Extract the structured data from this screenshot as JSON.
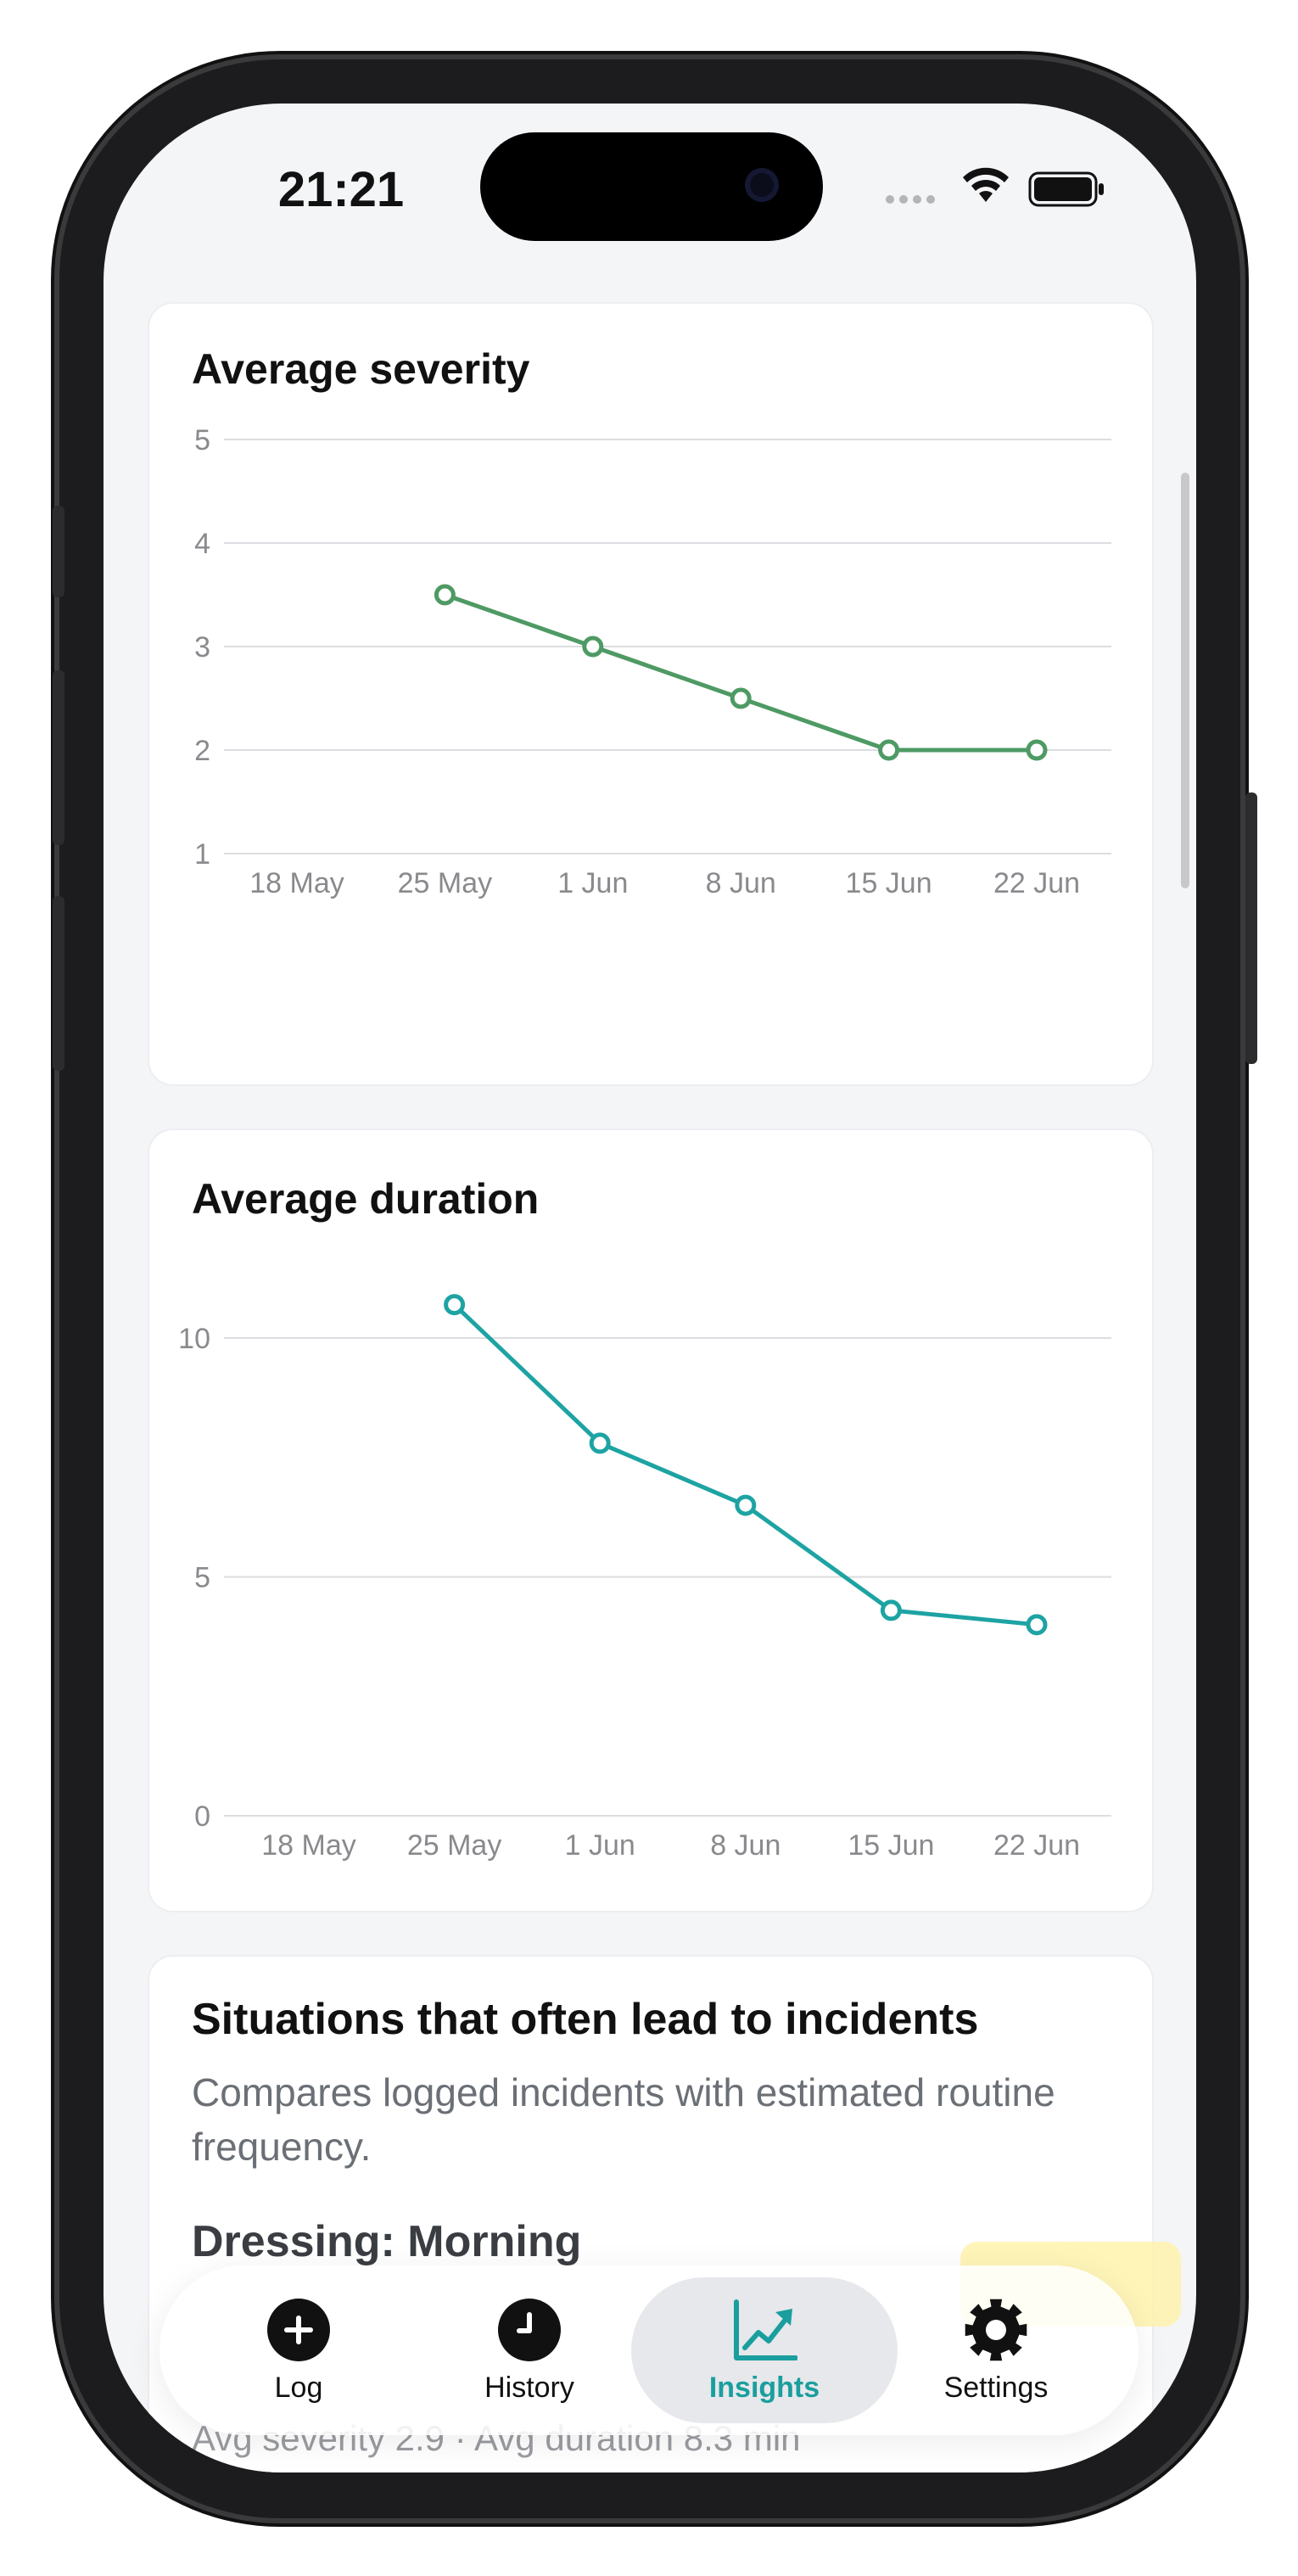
{
  "status_bar": {
    "time": "21:21"
  },
  "severity_card": {
    "title": "Average severity",
    "chart_data": {
      "type": "line",
      "title": "Average severity",
      "x": [
        "18 May",
        "25 May",
        "1 Jun",
        "8 Jun",
        "15 Jun",
        "22 Jun"
      ],
      "series": [
        {
          "values": [
            null,
            3.5,
            3.0,
            2.5,
            2.0,
            2.0
          ]
        }
      ],
      "ylim": [
        1,
        5
      ],
      "yticks": [
        1,
        2,
        3,
        4,
        5
      ],
      "grid": true,
      "color": "#4e9a64"
    }
  },
  "duration_card": {
    "title": "Average duration",
    "chart_data": {
      "type": "line",
      "title": "Average duration",
      "x": [
        "18 May",
        "25 May",
        "1 Jun",
        "8 Jun",
        "15 Jun",
        "22 Jun"
      ],
      "series": [
        {
          "values": [
            null,
            10.7,
            7.8,
            6.5,
            4.3,
            4.0
          ]
        }
      ],
      "ylim": [
        0,
        10.8
      ],
      "yticks": [
        0,
        5,
        10
      ],
      "grid": true,
      "color": "#1ea3a3"
    }
  },
  "situations_card": {
    "title": "Situations that often lead to incidents",
    "subtitle": "Compares logged incidents with estimated routine frequency.",
    "section_title": "Dressing: Morning",
    "stats_line": "Avg severity 2.9 · Avg duration 8.3 min"
  },
  "tabbar": {
    "tabs": [
      {
        "label": "Log",
        "icon": "plus-circle-icon"
      },
      {
        "label": "History",
        "icon": "clock-icon"
      },
      {
        "label": "Insights",
        "icon": "chart-trend-icon",
        "active": true
      },
      {
        "label": "Settings",
        "icon": "gear-icon"
      }
    ],
    "accent_color": "#1a9e9e"
  }
}
